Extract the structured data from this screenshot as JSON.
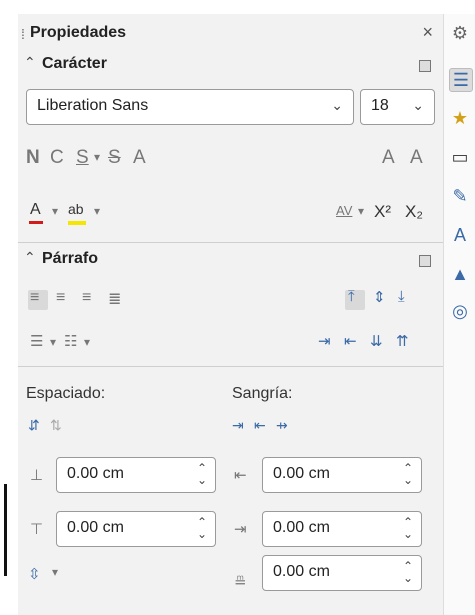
{
  "panel": {
    "title": "Propiedades",
    "close_label": "×",
    "grip": "⁞"
  },
  "character": {
    "heading": "Carácter",
    "font_name": "Liberation Sans",
    "font_size": "18",
    "bold": "N",
    "italic": "C",
    "underline": "S",
    "strikethrough": "S",
    "shadow": "A",
    "grow_font": "A",
    "shrink_font": "A",
    "font_color": "A",
    "highlight": "ab",
    "spacing": "AV",
    "superscript": "X²",
    "subscript": "X₂"
  },
  "paragraph": {
    "heading": "Párrafo"
  },
  "spacing": {
    "label": "Espaciado:",
    "above_value": "0.00 cm",
    "below_value": "0.00 cm"
  },
  "indent": {
    "label": "Sangría:",
    "before_value": "0.00 cm",
    "after_value": "0.00 cm",
    "first_line_value": "0.00 cm"
  },
  "colors": {
    "accent": "#3b6aa8",
    "font_color_bar": "#d21b1b",
    "highlight_bar": "#f5e600"
  }
}
